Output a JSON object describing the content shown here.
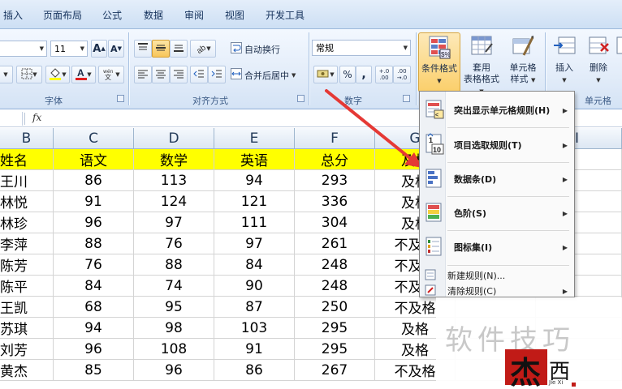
{
  "menu": [
    "插入",
    "页面布局",
    "公式",
    "数据",
    "审阅",
    "视图",
    "开发工具"
  ],
  "font_group": {
    "font_size": "11",
    "grow_font": "A",
    "shrink_font": "A",
    "label": "字体"
  },
  "align_group": {
    "wrap_text": "自动换行",
    "merge_center": "合并后居中",
    "label": "对齐方式"
  },
  "number_group": {
    "format": "常规",
    "percent": "%",
    "comma": ",",
    "inc_decimal": "+.0 .00",
    "dec_decimal": ".00 →.0",
    "label": "数字"
  },
  "style_group": {
    "conditional_format": "条件格式",
    "table_format_line1": "套用",
    "table_format_line2": "表格格式",
    "cell_style_line1": "单元格",
    "cell_style_line2": "样式"
  },
  "cells_group": {
    "insert": "插入",
    "delete": "删除",
    "label": "单元格"
  },
  "formula_bar": {
    "fx": "fx"
  },
  "columns": [
    "B",
    "C",
    "D",
    "E",
    "F",
    "G",
    "I"
  ],
  "table": {
    "headers": [
      "姓名",
      "语文",
      "数学",
      "英语",
      "总分",
      "及格"
    ],
    "rows": [
      [
        "王川",
        "86",
        "113",
        "94",
        "293",
        "及格"
      ],
      [
        "林悦",
        "91",
        "124",
        "121",
        "336",
        "及格"
      ],
      [
        "林珍",
        "96",
        "97",
        "111",
        "304",
        "及格"
      ],
      [
        "李萍",
        "88",
        "76",
        "97",
        "261",
        "不及格"
      ],
      [
        "陈芳",
        "76",
        "88",
        "84",
        "248",
        "不及格"
      ],
      [
        "陈平",
        "84",
        "74",
        "90",
        "248",
        "不及格"
      ],
      [
        "王凯",
        "68",
        "95",
        "87",
        "250",
        "不及格"
      ],
      [
        "苏琪",
        "94",
        "98",
        "103",
        "295",
        "及格"
      ],
      [
        "刘芳",
        "96",
        "108",
        "91",
        "295",
        "及格"
      ],
      [
        "黄杰",
        "85",
        "96",
        "86",
        "267",
        "不及格"
      ]
    ]
  },
  "cf_menu": {
    "items": [
      {
        "label": "突出显示单元格规则(H)",
        "icon": "highlight-rules-icon"
      },
      {
        "label": "项目选取规则(T)",
        "icon": "top-bottom-rules-icon"
      },
      {
        "label": "数据条(D)",
        "icon": "data-bars-icon"
      },
      {
        "label": "色阶(S)",
        "icon": "color-scales-icon"
      },
      {
        "label": "图标集(I)",
        "icon": "icon-sets-icon"
      }
    ],
    "new_rule": "新建规则(N)...",
    "clear_rules": "清除规则(C)"
  },
  "watermark": {
    "text": "软件技巧",
    "logo_char": "杰",
    "logo_side": "西",
    "logo_sub": "Jie Xi"
  }
}
